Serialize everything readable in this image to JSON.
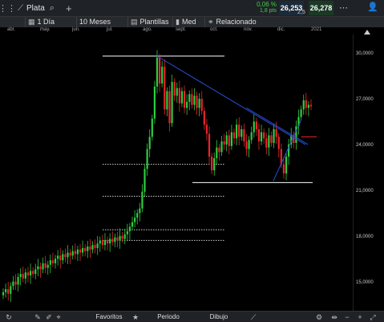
{
  "header": {
    "symbol": "Plata",
    "change_pct": "0,06 %",
    "change_pts": "1,8 pts",
    "sell_price": "26,253",
    "buy_price": "26,278",
    "spread": "2,5"
  },
  "toolbar": {
    "interval": "1 Día",
    "period": "10 Meses",
    "templates": "Plantillas",
    "price_type": "Med",
    "related": "Relacionado"
  },
  "months": [
    "abr.",
    "may.",
    "jun.",
    "jul.",
    "ago.",
    "sept.",
    "oct.",
    "nov.",
    "dic.",
    "2021"
  ],
  "bottom": {
    "favorites": "Favoritos",
    "period": "Periodo",
    "drawing": "Dibujo"
  },
  "icons": {
    "grid": "grid-icon",
    "symbol": "line-chart-icon",
    "search": "search-icon",
    "add": "plus-icon",
    "more": "dots-icon",
    "user": "user-icon"
  },
  "colors": {
    "up": "#2ecc40",
    "down": "#e8242b",
    "trendline": "#2a4fd8",
    "support": "#ffffff",
    "accent_green": "#3fcf4a"
  },
  "chart_data": {
    "type": "candlestick",
    "ylim": [
      13500,
      31000
    ],
    "y_ticks": [
      "30,0000",
      "27,0000",
      "24,0000",
      "21,0000",
      "18,0000",
      "15,0000"
    ],
    "y_tick_values": [
      30000,
      27000,
      24000,
      21000,
      18000,
      15000
    ],
    "grid": false,
    "last_price": 24600,
    "horizontal_lines": [
      {
        "style": "solid",
        "value": 29900
      },
      {
        "style": "solid",
        "value": 21600
      },
      {
        "style": "dotted",
        "value": 22800
      },
      {
        "style": "dotted",
        "value": 20700
      },
      {
        "style": "dotted",
        "value": 18500
      },
      {
        "style": "dotted",
        "value": 17800
      }
    ],
    "closes": [
      14400,
      14600,
      14300,
      14800,
      15100,
      14900,
      15400,
      15600,
      15300,
      15700,
      15500,
      15800,
      15600,
      15900,
      16100,
      15900,
      16300,
      16000,
      16200,
      16500,
      16300,
      16600,
      16800,
      16500,
      16900,
      16700,
      17000,
      16800,
      17100,
      16900,
      17200,
      17000,
      17300,
      17100,
      17400,
      17200,
      17500,
      17300,
      17600,
      17800,
      17500,
      17800,
      17600,
      17900,
      17700,
      18000,
      17800,
      18100,
      17900,
      18200,
      18400,
      18700,
      19000,
      19300,
      19600,
      19900,
      21000,
      22500,
      23800,
      24600,
      25800,
      27900,
      29800,
      28100,
      29200,
      26400,
      27600,
      25500,
      28200,
      27300,
      27800,
      26800,
      27600,
      26500,
      26900,
      27400,
      26700,
      27300,
      26500,
      27100,
      26300,
      25400,
      24800,
      23300,
      22400,
      23200,
      23900,
      23600,
      24300,
      24100,
      24700,
      24000,
      24900,
      24500,
      25400,
      24600,
      25100,
      24300,
      23800,
      24400,
      24900,
      25600,
      25100,
      24300,
      24900,
      24500,
      23900,
      24700,
      24200,
      25100,
      24600,
      23800,
      22800,
      22200,
      23300,
      24100,
      24700,
      24200,
      25300,
      25900,
      26400,
      27000,
      26500,
      26700,
      26600
    ]
  }
}
